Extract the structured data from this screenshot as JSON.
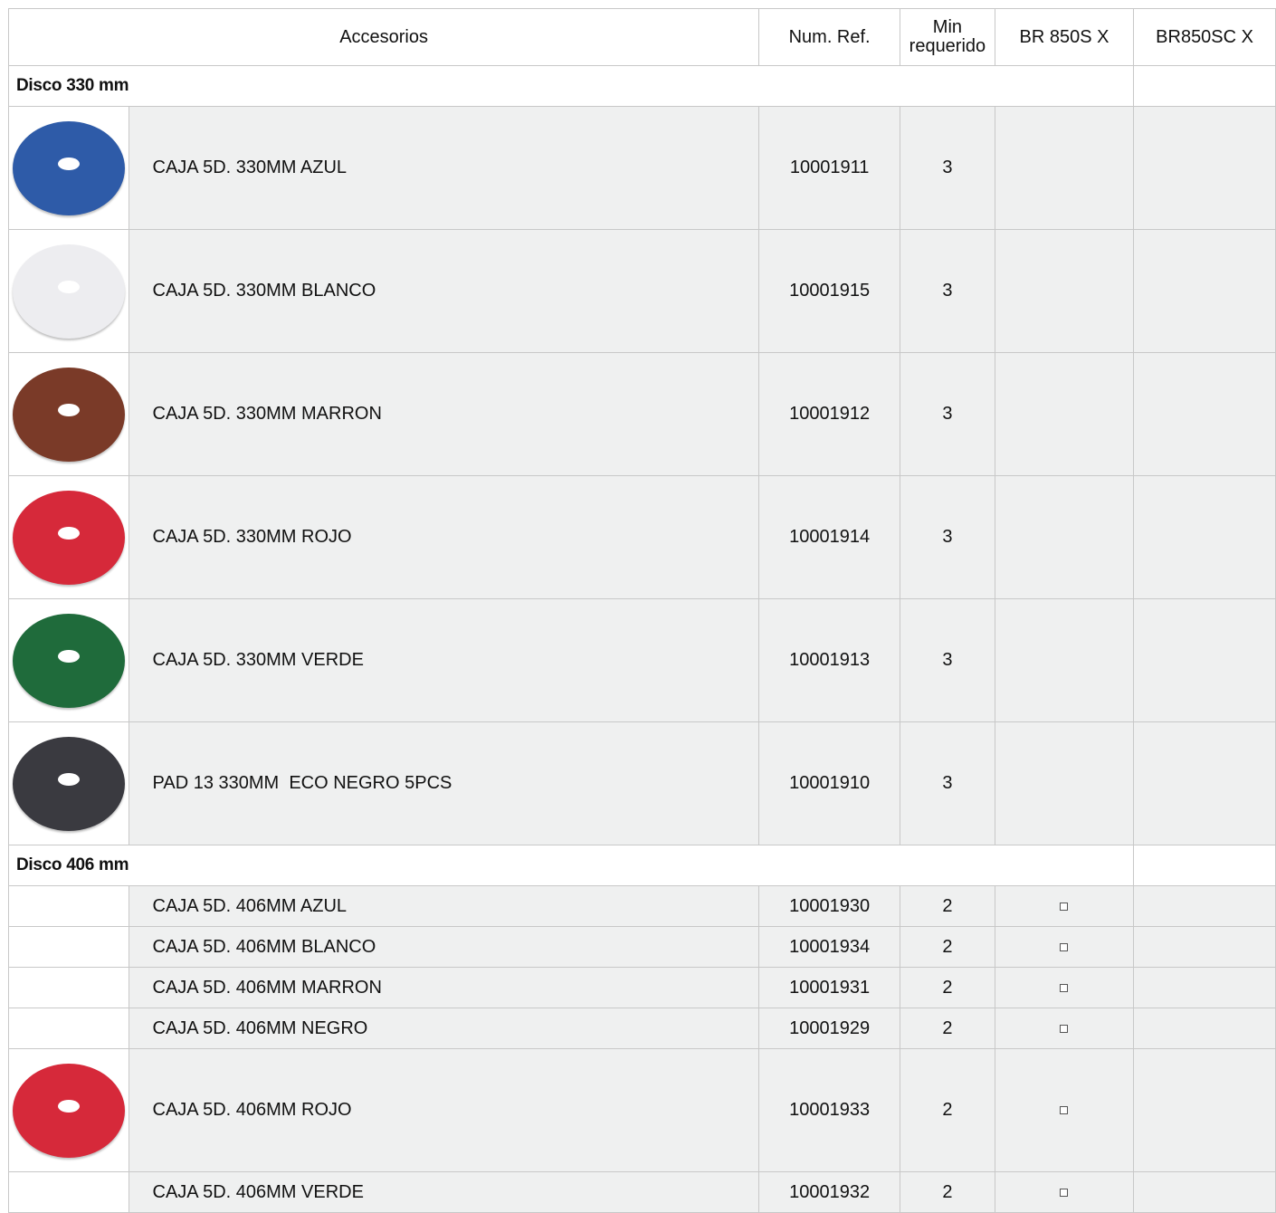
{
  "header": {
    "accesorios": "Accesorios",
    "num_ref": "Num. Ref.",
    "min_line1": "Min",
    "min_line2": "requerido",
    "br1": "BR 850S X",
    "br2": "BR850SC X"
  },
  "sections": [
    {
      "title": "Disco 330 mm",
      "rows": [
        {
          "name": "CAJA 5D. 330MM AZUL",
          "ref": "10001911",
          "min": "3",
          "disc_color": "#2e5ba8"
        },
        {
          "name": "CAJA 5D. 330MM BLANCO",
          "ref": "10001915",
          "min": "3",
          "disc_color": "#ededf0"
        },
        {
          "name": "CAJA 5D. 330MM MARRON",
          "ref": "10001912",
          "min": "3",
          "disc_color": "#7a3a28"
        },
        {
          "name": "CAJA 5D. 330MM ROJO",
          "ref": "10001914",
          "min": "3",
          "disc_color": "#d6293a"
        },
        {
          "name": "CAJA 5D. 330MM VERDE",
          "ref": "10001913",
          "min": "3",
          "disc_color": "#1f6b3b"
        },
        {
          "name": "PAD 13 330MM  ECO NEGRO 5PCS",
          "ref": "10001910",
          "min": "3",
          "disc_color": "#3a3a40"
        }
      ]
    },
    {
      "title": "Disco 406 mm",
      "rows": [
        {
          "name": "CAJA 5D. 406MM AZUL",
          "ref": "10001930",
          "min": "2",
          "check": "□"
        },
        {
          "name": "CAJA 5D. 406MM BLANCO",
          "ref": "10001934",
          "min": "2",
          "check": "□"
        },
        {
          "name": "CAJA 5D. 406MM MARRON",
          "ref": "10001931",
          "min": "2",
          "check": "□"
        },
        {
          "name": "CAJA 5D. 406MM NEGRO",
          "ref": "10001929",
          "min": "2",
          "check": "□"
        },
        {
          "name": "CAJA 5D. 406MM ROJO",
          "ref": "10001933",
          "min": "2",
          "check": "□",
          "disc_color": "#d6293a"
        },
        {
          "name": "CAJA 5D. 406MM VERDE",
          "ref": "10001932",
          "min": "2",
          "check": "□"
        }
      ]
    }
  ]
}
